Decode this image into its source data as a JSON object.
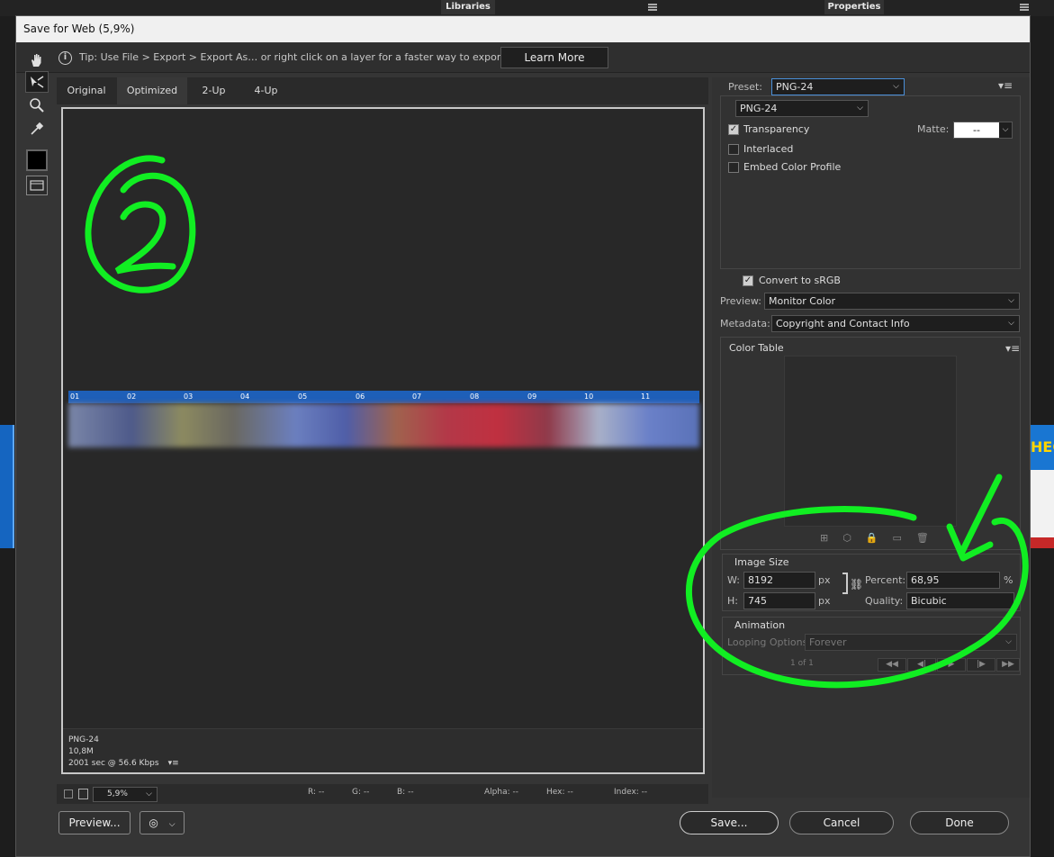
{
  "background": {
    "tab_libraries": "Libraries",
    "tab_properties": "Properties",
    "thumb_text": "HEC"
  },
  "dialog": {
    "title": "Save for Web (5,9%)",
    "tip": "Tip: Use File > Export > Export As…  or right click on a layer for a faster way to export assets",
    "learn_more": "Learn More"
  },
  "tabs": [
    "Original",
    "Optimized",
    "2-Up",
    "4-Up"
  ],
  "active_tab": "Optimized",
  "canvas": {
    "format": "PNG-24",
    "size": "10,8M",
    "time": "2001 sec @ 56.6 Kbps",
    "banner_segments": [
      "01",
      "02",
      "03",
      "04",
      "05",
      "06",
      "07",
      "08",
      "09",
      "10",
      "11"
    ],
    "annotation_number": "2"
  },
  "status": {
    "zoom": "5,9%",
    "r": "R: --",
    "g": "G: --",
    "b": "B: --",
    "alpha": "Alpha: --",
    "hex": "Hex: --",
    "index": "Index: --"
  },
  "buttons": {
    "preview": "Preview...",
    "save": "Save...",
    "cancel": "Cancel",
    "done": "Done"
  },
  "settings": {
    "preset_label": "Preset:",
    "preset_value": "PNG-24",
    "format_value": "PNG-24",
    "transparency": "Transparency",
    "interlaced": "Interlaced",
    "embed_color": "Embed Color Profile",
    "matte_label": "Matte:",
    "matte_value": "--",
    "convert_srgb": "Convert to sRGB",
    "preview_label": "Preview:",
    "preview_value": "Monitor Color",
    "metadata_label": "Metadata:",
    "metadata_value": "Copyright and Contact Info",
    "color_table": "Color Table"
  },
  "image_size": {
    "heading": "Image Size",
    "w_label": "W:",
    "w_value": "8192",
    "h_label": "H:",
    "h_value": "745",
    "unit": "px",
    "percent_label": "Percent:",
    "percent_value": "68,95",
    "percent_unit": "%",
    "quality_label": "Quality:",
    "quality_value": "Bicubic"
  },
  "animation": {
    "heading": "Animation",
    "looping_label": "Looping Options:",
    "looping_value": "Forever",
    "frame_counter": "1 of 1"
  },
  "colors": {
    "annotation_green": "#11ee22",
    "dialog_bg": "#353535",
    "banner_blue": "#1e5fb8"
  }
}
